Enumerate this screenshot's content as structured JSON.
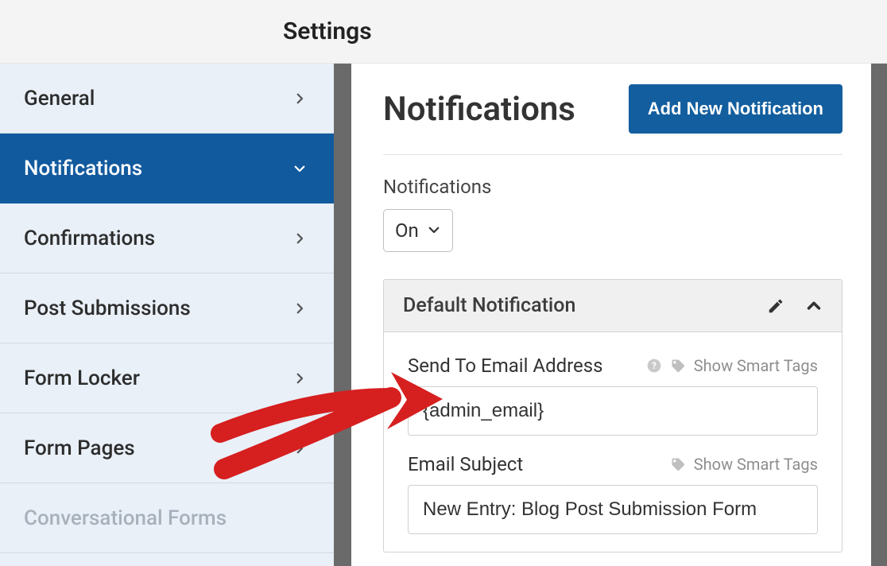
{
  "topbar": {
    "title": "Settings"
  },
  "sidebar": {
    "items": [
      {
        "label": "General"
      },
      {
        "label": "Notifications"
      },
      {
        "label": "Confirmations"
      },
      {
        "label": "Post Submissions"
      },
      {
        "label": "Form Locker"
      },
      {
        "label": "Form Pages"
      },
      {
        "label": "Conversational Forms"
      }
    ]
  },
  "page": {
    "title": "Notifications",
    "add_button": "Add New Notification",
    "notifications_label": "Notifications",
    "toggle_value": "On"
  },
  "card": {
    "title": "Default Notification",
    "send_to_label": "Send To Email Address",
    "send_to_value": "{admin_email}",
    "smart_tags_label": "Show Smart Tags",
    "subject_label": "Email Subject",
    "subject_value": "New Entry: Blog Post Submission Form"
  }
}
